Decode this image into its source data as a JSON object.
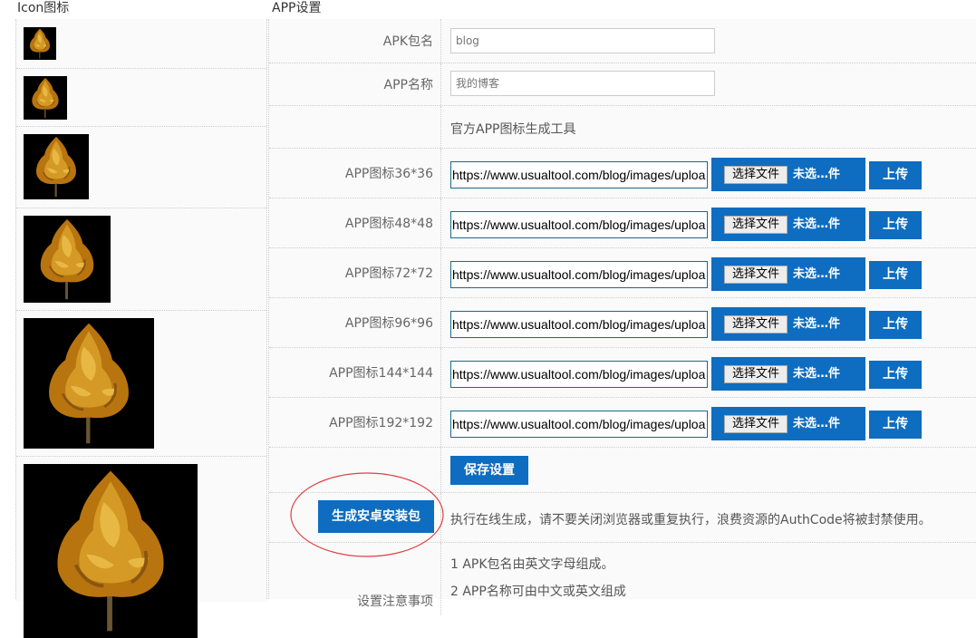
{
  "headers": {
    "icons": "Icon图标",
    "settings": "APP设置"
  },
  "colors": {
    "accent": "#0e6dc0",
    "annotation": "#e04040",
    "thumb_bg": "#000000"
  },
  "fields": {
    "apk_package": {
      "label": "APK包名",
      "value": "blog"
    },
    "app_name": {
      "label": "APP名称",
      "value": "我的博客"
    }
  },
  "tool_link": "官方APP图标生成工具",
  "icon_rows": [
    {
      "label": "APP图标36*36",
      "url": "https://www.usualtool.com/blog/images/upload",
      "file_button": "选择文件",
      "file_status": "未选…件",
      "upload_label": "上传"
    },
    {
      "label": "APP图标48*48",
      "url": "https://www.usualtool.com/blog/images/upload",
      "file_button": "选择文件",
      "file_status": "未选…件",
      "upload_label": "上传"
    },
    {
      "label": "APP图标72*72",
      "url": "https://www.usualtool.com/blog/images/upload",
      "file_button": "选择文件",
      "file_status": "未选…件",
      "upload_label": "上传"
    },
    {
      "label": "APP图标96*96",
      "url": "https://www.usualtool.com/blog/images/upload",
      "file_button": "选择文件",
      "file_status": "未选…件",
      "upload_label": "上传"
    },
    {
      "label": "APP图标144*144",
      "url": "https://www.usualtool.com/blog/images/upload",
      "file_button": "选择文件",
      "file_status": "未选…件",
      "upload_label": "上传"
    },
    {
      "label": "APP图标192*192",
      "url": "https://www.usualtool.com/blog/images/upload",
      "file_button": "选择文件",
      "file_status": "未选…件",
      "upload_label": "上传"
    }
  ],
  "save_label": "保存设置",
  "generate_label": "生成安卓安装包",
  "generate_note": "执行在线生成，请不要关闭浏览器或重复执行，浪费资源的AuthCode将被封禁使用。",
  "notes": {
    "label": "设置注意事项",
    "items": [
      "1 APK包名由英文字母组成。",
      "2 APP名称可由中文或英文组成"
    ]
  }
}
